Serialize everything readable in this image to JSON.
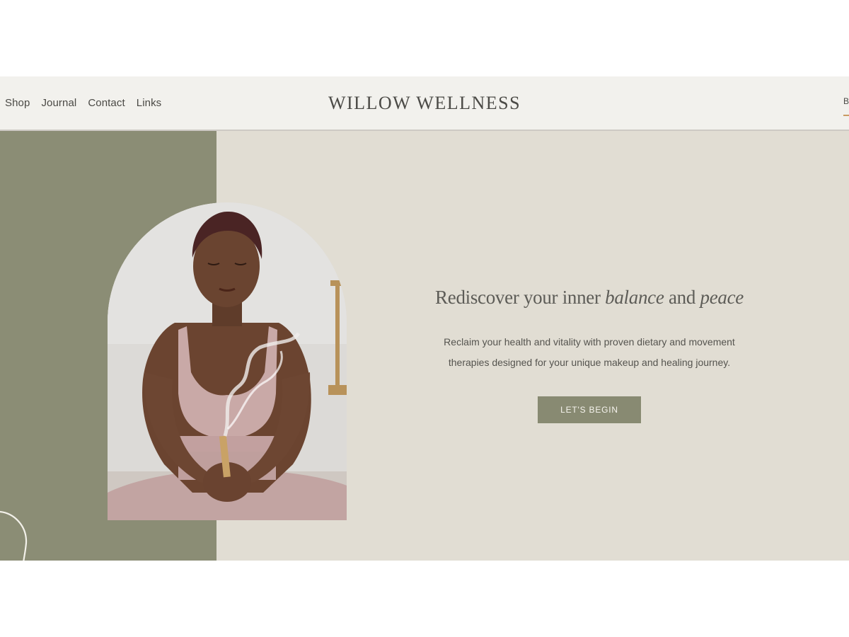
{
  "header": {
    "nav_items": [
      {
        "label": "Shop"
      },
      {
        "label": "Journal"
      },
      {
        "label": "Contact"
      },
      {
        "label": "Links"
      }
    ],
    "brand": "WILLOW WELLNESS",
    "cta_partial": "B"
  },
  "hero": {
    "title_parts": {
      "part1": "Rediscover your inner ",
      "em1": "balance",
      "part2": " and ",
      "em2": "peace"
    },
    "body_line1": "Reclaim your health and vitality with proven dietary and movement",
    "body_line2": "therapies designed for your unique makeup and healing journey.",
    "cta_label": "LET'S BEGIN"
  },
  "colors": {
    "header_bg": "#f2f1ed",
    "sage": "#8b8d75",
    "beige": "#e1ddd3",
    "button": "#888a72",
    "accent_underline": "#c99a62"
  }
}
